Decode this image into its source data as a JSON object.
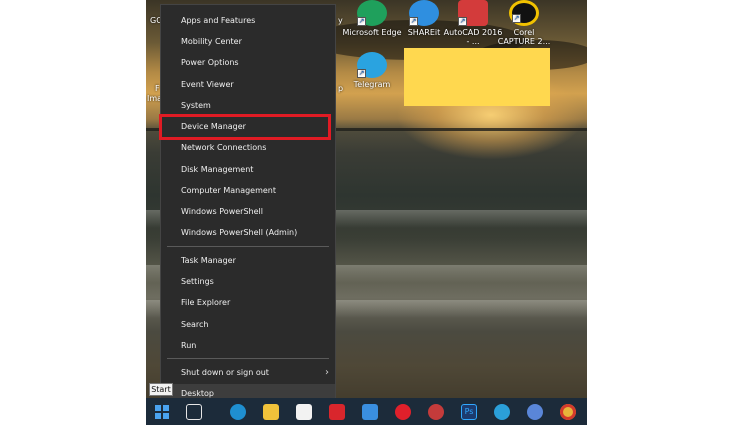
{
  "desktop_icons": [
    {
      "label": "Microsoft Edge",
      "color": "#1fa05c",
      "icon": "edge-icon"
    },
    {
      "label": "SHAREit",
      "color": "#2f8fe0",
      "icon": "shareit-icon"
    },
    {
      "label": "AutoCAD 2016 - ...",
      "color": "#d33b3b",
      "icon": "autocad-icon"
    },
    {
      "label": "Corel CAPTURE 2...",
      "color": "#f2c200",
      "icon": "corel-capture-icon"
    },
    {
      "label": "Telegram",
      "color": "#2aa3e0",
      "icon": "telegram-icon"
    }
  ],
  "left_fragments": [
    "GC",
    "F",
    "Ima"
  ],
  "right_fragments": [
    "y",
    "p"
  ],
  "context_menu": {
    "items": [
      "Apps and Features",
      "Mobility Center",
      "Power Options",
      "Event Viewer",
      "System",
      "Device Manager",
      "Network Connections",
      "Disk Management",
      "Computer Management",
      "Windows PowerShell",
      "Windows PowerShell (Admin)",
      "Task Manager",
      "Settings",
      "File Explorer",
      "Search",
      "Run",
      "Shut down or sign out",
      "Desktop"
    ],
    "highlighted": "Device Manager",
    "submenu_chevron": "›"
  },
  "tooltip": {
    "text": "Start"
  },
  "taskbar": {
    "icons": [
      {
        "name": "start-icon",
        "color": "#4aa3f0"
      },
      {
        "name": "task-view-icon",
        "color": "#e6e6e6"
      },
      {
        "name": "edge-icon",
        "color": "#1f8fd0"
      },
      {
        "name": "file-explorer-icon",
        "color": "#f0c23a"
      },
      {
        "name": "store-icon",
        "color": "#f2f2f2"
      },
      {
        "name": "gift-app-icon",
        "color": "#d9262c"
      },
      {
        "name": "mail-icon",
        "color": "#3a8fe0"
      },
      {
        "name": "opera-icon",
        "color": "#e0202b"
      },
      {
        "name": "chrome-alt-icon",
        "color": "#c43b3b"
      },
      {
        "name": "photoshop-icon",
        "color": "#1c3b6e"
      },
      {
        "name": "edge-new-icon",
        "color": "#2b9fd9"
      },
      {
        "name": "chromium-icon",
        "color": "#5a86d8"
      },
      {
        "name": "chrome-icon",
        "color": "#e8b53a"
      }
    ],
    "photoshop_label": "Ps"
  },
  "colors": {
    "menu_bg": "#2b2b2b",
    "highlight_border": "#e01b24",
    "yellow_block": "#ffd84f",
    "taskbar_bg": "#1c2b3a"
  }
}
